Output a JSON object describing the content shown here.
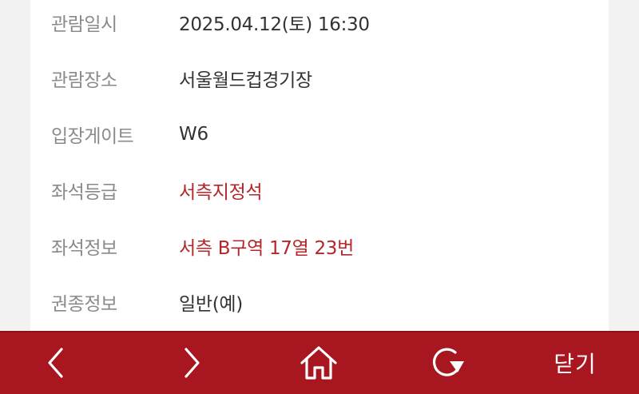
{
  "ticket_info": {
    "rows": [
      {
        "label": "관람일시",
        "value": "2025.04.12(토) 16:30"
      },
      {
        "label": "관람장소",
        "value": "서울월드컵경기장"
      },
      {
        "label": "입장게이트",
        "value": "W6"
      },
      {
        "label": "좌석등급",
        "value": "서측지정석"
      },
      {
        "label": "좌석정보",
        "value": "서측 B구역 17열 23번"
      },
      {
        "label": "권종정보",
        "value": "일반(예)"
      }
    ]
  },
  "toolbar": {
    "back_icon": "chevron-left-icon",
    "forward_icon": "chevron-right-icon",
    "home_icon": "home-icon",
    "refresh_icon": "refresh-icon",
    "close_label": "닫기"
  },
  "colors": {
    "toolbar_bg": "#a8161f",
    "accent_text": "#b3262a",
    "label_text": "#8a8a8a",
    "value_text": "#333333"
  }
}
